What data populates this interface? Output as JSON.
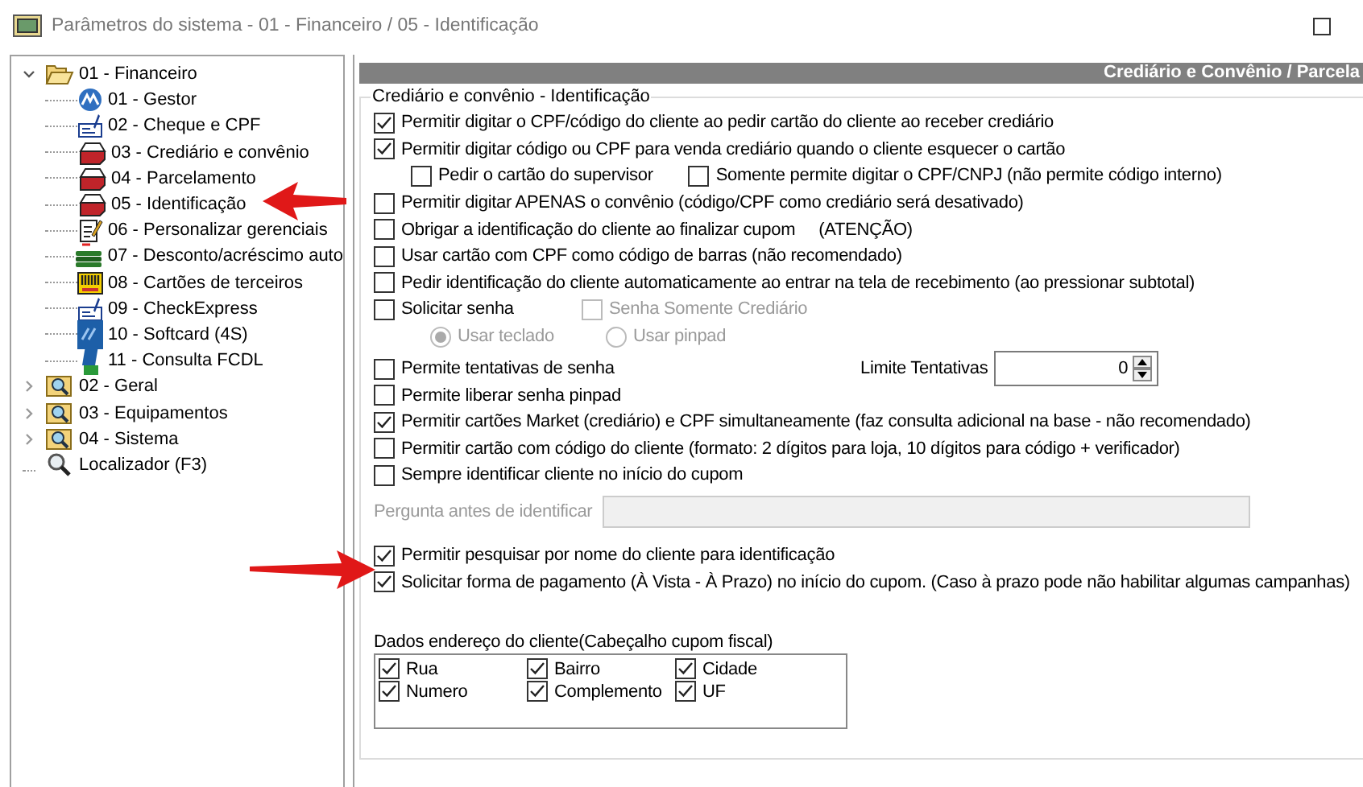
{
  "window": {
    "title": "Parâmetros do sistema - 01 - Financeiro / 05 - Identificação"
  },
  "tree": [
    {
      "label": "01 - Financeiro",
      "kind": "folder-open",
      "expanded": true,
      "children": [
        {
          "label": "01 - Gestor",
          "kind": "globe"
        },
        {
          "label": "02 - Cheque e CPF",
          "kind": "cheque"
        },
        {
          "label": "03 - Crediário e convênio",
          "kind": "drawer"
        },
        {
          "label": "04 - Parcelamento",
          "kind": "drawer"
        },
        {
          "label": "05 - Identificação",
          "kind": "drawer"
        },
        {
          "label": "06 - Personalizar gerenciais",
          "kind": "notepad"
        },
        {
          "label": "07 - Desconto/acréscimo auto",
          "kind": "money"
        },
        {
          "label": "08 - Cartões de terceiros",
          "kind": "card"
        },
        {
          "label": "09 - CheckExpress",
          "kind": "cheque"
        },
        {
          "label": "10 - Softcard (4S)",
          "kind": "softcard"
        },
        {
          "label": "11 - Consulta FCDL",
          "kind": "device"
        }
      ]
    },
    {
      "label": "02 - Geral",
      "kind": "folder-search",
      "expanded": false
    },
    {
      "label": "03 - Equipamentos",
      "kind": "folder-search",
      "expanded": false
    },
    {
      "label": "04 - Sistema",
      "kind": "folder-search",
      "expanded": false
    },
    {
      "label": "Localizador (F3)",
      "kind": "magnifier"
    }
  ],
  "header": "Crediário e Convênio / Parcela",
  "group": {
    "title": "Crediário e convênio - Identificação",
    "options": [
      {
        "kind": "check",
        "label": "Permitir digitar o CPF/código do cliente ao pedir cartão do cliente ao receber crediário",
        "checked": true
      },
      {
        "kind": "check",
        "label": "Permitir digitar código ou CPF para venda crediário quando o cliente esquecer o cartão",
        "checked": true
      },
      {
        "kind": "subchecks",
        "items": [
          {
            "label": "Pedir o cartão do supervisor",
            "checked": false,
            "disabled": false
          },
          {
            "label": "Somente permite digitar o CPF/CNPJ (não permite código interno)",
            "checked": false,
            "disabled": false
          }
        ]
      },
      {
        "kind": "check",
        "label": "Permitir digitar APENAS o convênio (código/CPF como crediário será desativado)",
        "checked": false
      },
      {
        "kind": "check",
        "label": "Obrigar a identificação do cliente ao finalizar cupom     (ATENÇÃO)",
        "checked": false
      },
      {
        "kind": "check",
        "label": "Usar cartão com CPF como código de barras (não recomendado)",
        "checked": false
      },
      {
        "kind": "check",
        "label": "Pedir identificação do cliente automaticamente ao entrar na tela de recebimento (ao pressionar subtotal)",
        "checked": false
      },
      {
        "kind": "checkpair",
        "items": [
          {
            "label": "Solicitar senha",
            "checked": false,
            "disabled": false
          },
          {
            "label": "Senha Somente Crediário",
            "checked": false,
            "disabled": true
          }
        ]
      },
      {
        "kind": "radios",
        "items": [
          {
            "label": "Usar teclado",
            "selected": true,
            "disabled": true
          },
          {
            "label": "Usar pinpad",
            "selected": false,
            "disabled": true
          }
        ]
      },
      {
        "kind": "checkspin",
        "label": "Permite tentativas de senha",
        "checked": false,
        "spin_label": "Limite Tentativas",
        "spin_value": "0"
      },
      {
        "kind": "check",
        "label": "Permite liberar senha pinpad",
        "checked": false
      },
      {
        "kind": "check",
        "label": "Permitir cartões Market (crediário) e CPF simultaneamente (faz consulta adicional na base - não recomendado)",
        "checked": true
      },
      {
        "kind": "check",
        "label": "Permitir cartão com código do cliente (formato: 2 dígitos para loja, 10 dígitos para código + verificador)",
        "checked": false
      },
      {
        "kind": "check",
        "label": "Sempre identificar cliente no início do cupom",
        "checked": false
      },
      {
        "kind": "field",
        "label": "Pergunta antes de identificar",
        "disabled": true
      },
      {
        "kind": "gap"
      },
      {
        "kind": "check",
        "label": "Permitir pesquisar por nome do cliente para identificação",
        "checked": true
      },
      {
        "kind": "check",
        "label": "Solicitar forma de pagamento (À Vista - À Prazo) no início do cupom. (Caso à prazo pode não habilitar algumas campanhas)",
        "checked": true
      }
    ]
  },
  "address": {
    "title": "Dados endereço do cliente(Cabeçalho cupom fiscal)",
    "items": [
      {
        "label": "Rua",
        "checked": true
      },
      {
        "label": "Bairro",
        "checked": true
      },
      {
        "label": "Cidade",
        "checked": true
      },
      {
        "label": "Numero",
        "checked": true
      },
      {
        "label": "Complemento",
        "checked": true
      },
      {
        "label": "UF",
        "checked": true
      }
    ]
  }
}
